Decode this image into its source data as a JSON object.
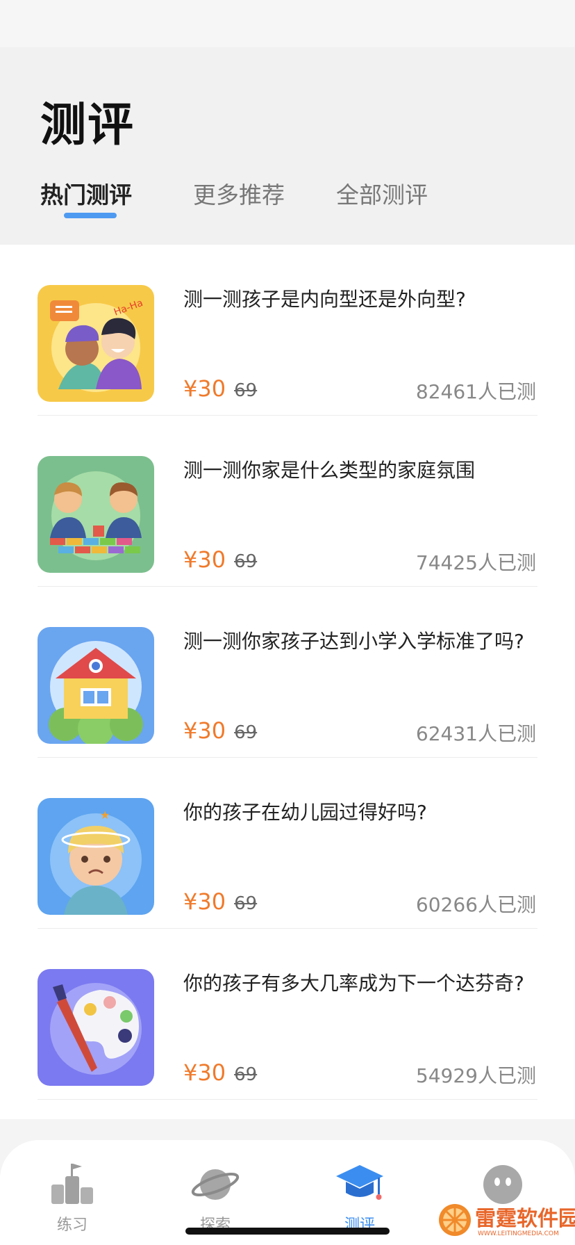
{
  "header": {
    "title": "测评",
    "tabs": [
      {
        "label": "热门测评",
        "active": true
      },
      {
        "label": "更多推荐",
        "active": false
      },
      {
        "label": "全部测评",
        "active": false
      }
    ]
  },
  "colors": {
    "accent": "#4e9af1",
    "price": "#f07a2b"
  },
  "assessments": [
    {
      "title": "测一测孩子是内向型还是外向型?",
      "price": "¥30",
      "original_price": "69",
      "count": "82461人已测",
      "icon": "two-kids-chatting-illustration"
    },
    {
      "title": "测一测你家是什么类型的家庭氛围",
      "price": "¥30",
      "original_price": "69",
      "count": "74425人已测",
      "icon": "kids-building-blocks-illustration"
    },
    {
      "title": "测一测你家孩子达到小学入学标准了吗?",
      "price": "¥30",
      "original_price": "69",
      "count": "62431人已测",
      "icon": "school-house-illustration"
    },
    {
      "title": "你的孩子在幼儿园过得好吗?",
      "price": "¥30",
      "original_price": "69",
      "count": "60266人已测",
      "icon": "dizzy-child-illustration"
    },
    {
      "title": "你的孩子有多大几率成为下一个达芬奇?",
      "price": "¥30",
      "original_price": "69",
      "count": "54929人已测",
      "icon": "paint-palette-illustration"
    }
  ],
  "tabbar": {
    "items": [
      {
        "label": "练习",
        "icon": "podium-flag-icon",
        "active": false
      },
      {
        "label": "探索",
        "icon": "planet-icon",
        "active": false
      },
      {
        "label": "测评",
        "icon": "graduation-cap-icon",
        "active": true
      },
      {
        "label": "",
        "icon": "profile-face-icon",
        "active": false
      }
    ]
  },
  "watermark": {
    "name": "雷霆软件园",
    "url": "WWW.LEITINGMEDIA.COM"
  }
}
